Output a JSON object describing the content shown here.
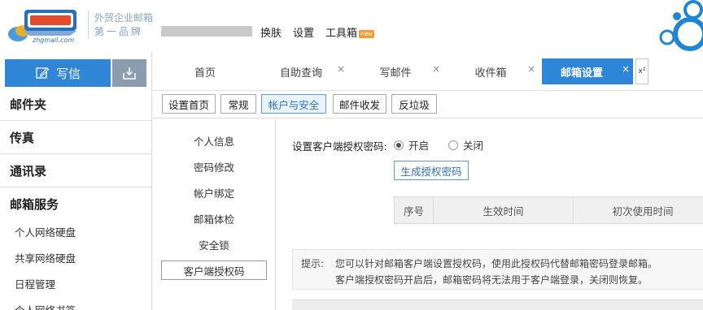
{
  "header": {
    "brand_line1": "外贸企业邮箱",
    "brand_line2": "第一品牌",
    "logo_text": "zhgmail.com",
    "links": [
      {
        "label": "换肤"
      },
      {
        "label": "设置"
      },
      {
        "label": "工具箱",
        "badge": "new"
      }
    ]
  },
  "sidebar": {
    "compose_label": "写信",
    "sections": [
      {
        "label": "邮件夹"
      },
      {
        "label": "传真"
      },
      {
        "label": "通讯录"
      },
      {
        "label": "邮箱服务"
      }
    ],
    "service_items": [
      {
        "label": "个人网络硬盘"
      },
      {
        "label": "共享网络硬盘"
      },
      {
        "label": "日程管理"
      },
      {
        "label": "个人网络书签"
      }
    ]
  },
  "tabs": [
    {
      "label": "首页",
      "closable": false,
      "active": false
    },
    {
      "label": "自助查询",
      "closable": true,
      "active": false
    },
    {
      "label": "写邮件",
      "closable": true,
      "active": false
    },
    {
      "label": "收件箱",
      "closable": true,
      "active": false
    },
    {
      "label": "邮箱设置",
      "closable": true,
      "active": true
    }
  ],
  "tab_close_glyph": "×",
  "tab_expand_glyph": "x²",
  "subtabs": [
    {
      "label": "设置首页",
      "active": false
    },
    {
      "label": "常规",
      "active": false
    },
    {
      "label": "帐户与安全",
      "active": true
    },
    {
      "label": "邮件收发",
      "active": false
    },
    {
      "label": "反垃圾",
      "active": false
    }
  ],
  "settings_menu": [
    {
      "label": "个人信息",
      "active": false
    },
    {
      "label": "密码修改",
      "active": false
    },
    {
      "label": "帐户绑定",
      "active": false
    },
    {
      "label": "邮箱体检",
      "active": false
    },
    {
      "label": "安全锁",
      "active": false
    },
    {
      "label": "客户端授权码",
      "active": true
    }
  ],
  "main": {
    "setting_label": "设置客户端授权密码:",
    "option_on": "开启",
    "option_off": "关闭",
    "selected": "on",
    "generate_button": "生成授权密码",
    "table_headers": [
      "序号",
      "生效时间",
      "初次使用时间"
    ],
    "tip_label": "提示:",
    "tip_line1": "您可以针对邮箱客户端设置授权码，使用此授权码代替邮箱密码登录邮箱。",
    "tip_line2": "客户端授权密码开启后，邮箱密码将无法用于客户端登录，关闭则恢复。"
  },
  "colors": {
    "primary": "#2f86d7",
    "receive_button": "#8a9cae",
    "brand_text": "#8aa7c7",
    "bubble": "#1f86d6"
  }
}
